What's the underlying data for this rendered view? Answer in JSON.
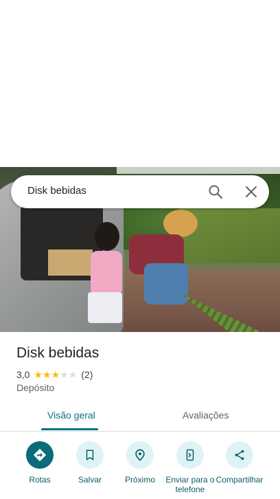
{
  "search": {
    "query": "Disk bebidas"
  },
  "place": {
    "name": "Disk bebidas",
    "rating": "3,0",
    "rating_value": 3,
    "rating_max": 5,
    "review_count": "(2)",
    "category": "Depósito"
  },
  "tabs": [
    {
      "label": "Visão geral",
      "active": true
    },
    {
      "label": "Avaliações",
      "active": false
    }
  ],
  "actions": [
    {
      "label": "Rotas",
      "icon": "directions-icon"
    },
    {
      "label": "Salvar",
      "icon": "bookmark-icon"
    },
    {
      "label": "Próximo",
      "icon": "nearby-icon"
    },
    {
      "label": "Enviar para o\ntelefone",
      "icon": "send-to-phone-icon"
    },
    {
      "label": "Compartilhar",
      "icon": "share-icon"
    }
  ],
  "colors": {
    "accent": "#0b7285",
    "primary_action": "#0b6b7a",
    "action_bg": "#dff3f6",
    "star_filled": "#fbbc04",
    "star_empty": "#dadce0"
  }
}
